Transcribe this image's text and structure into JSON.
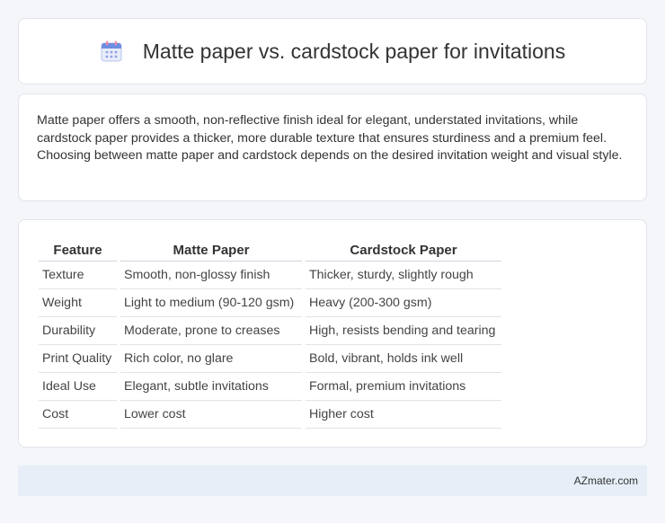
{
  "header": {
    "icon": "calendar-icon",
    "title": "Matte paper vs. cardstock paper for invitations"
  },
  "summary": {
    "text": "Matte paper offers a smooth, non-reflective finish ideal for elegant, understated invitations, while cardstock paper provides a thicker, more durable texture that ensures sturdiness and a premium feel. Choosing between matte paper and cardstock depends on the desired invitation weight and visual style."
  },
  "table": {
    "headers": [
      "Feature",
      "Matte Paper",
      "Cardstock Paper"
    ],
    "rows": [
      [
        "Texture",
        "Smooth, non-glossy finish",
        "Thicker, sturdy, slightly rough"
      ],
      [
        "Weight",
        "Light to medium (90-120 gsm)",
        "Heavy (200-300 gsm)"
      ],
      [
        "Durability",
        "Moderate, prone to creases",
        "High, resists bending and tearing"
      ],
      [
        "Print Quality",
        "Rich color, no glare",
        "Bold, vibrant, holds ink well"
      ],
      [
        "Ideal Use",
        "Elegant, subtle invitations",
        "Formal, premium invitations"
      ],
      [
        "Cost",
        "Lower cost",
        "Higher cost"
      ]
    ]
  },
  "footer": {
    "brand": "AZmater.com"
  },
  "colors": {
    "background": "#f4f6f9",
    "card": "#ffffff",
    "footer": "#e7eef8",
    "icon_accent": "#6f8de0"
  }
}
